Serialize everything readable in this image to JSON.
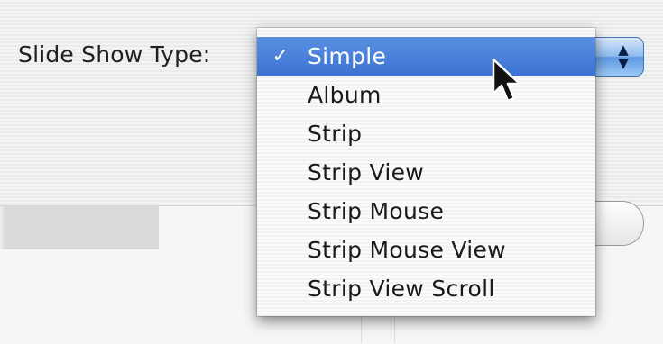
{
  "dialog": {
    "slide_show_type_label": "Slide Show Type:"
  },
  "popup": {
    "selected_value": "Simple",
    "stepper_up_glyph": "▲",
    "stepper_down_glyph": "▼",
    "check_glyph": "✓",
    "options": [
      {
        "label": "Simple",
        "selected": true
      },
      {
        "label": "Album",
        "selected": false
      },
      {
        "label": "Strip",
        "selected": false
      },
      {
        "label": "Strip View",
        "selected": false
      },
      {
        "label": "Strip Mouse",
        "selected": false
      },
      {
        "label": "Strip Mouse View",
        "selected": false
      },
      {
        "label": "Strip View Scroll",
        "selected": false
      }
    ]
  },
  "colors": {
    "selection_blue": "#3b73d4",
    "aqua_button": "#5c98e2"
  },
  "icons": {
    "cursor": "arrow-cursor-icon",
    "check": "checkmark-icon",
    "stepper": "popup-stepper-icon"
  }
}
